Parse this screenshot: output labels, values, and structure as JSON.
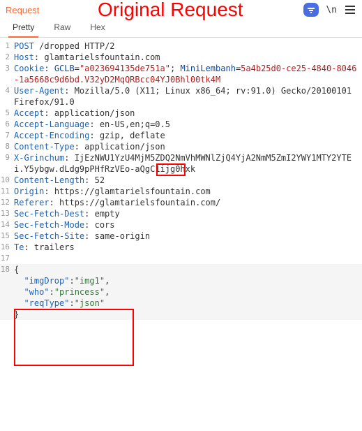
{
  "panel_title": "Request",
  "annotation": "Original Request",
  "escape_text": "\\n",
  "tabs": {
    "pretty": "Pretty",
    "raw": "Raw",
    "hex": "Hex"
  },
  "lines": {
    "l1": {
      "method": "POST",
      "path": "/dropped",
      "proto": "HTTP/2"
    },
    "l2": {
      "name": "Host",
      "val": "glamtarielsfountain.com"
    },
    "l3": {
      "name": "Cookie",
      "k1": "GCLB",
      "v1": "\"a023694135de751a\"",
      "k2": "MiniLembanh",
      "cont": "5a4b25d0-ce25-4840-8046-1a5668c9d6bd.V32yD2MqQRBcc04YJ0Bhl00tk4M"
    },
    "l4": {
      "name": "User-Agent",
      "val": "Mozilla/5.0 (X11; Linux x86_64; rv:91.0) Gecko/20100101 Firefox/91.0"
    },
    "l5": {
      "name": "Accept",
      "val": "application/json"
    },
    "l6": {
      "name": "Accept-Language",
      "val": "en-US,en;q=0.5"
    },
    "l7": {
      "name": "Accept-Encoding",
      "val": "gzip, deflate"
    },
    "l8": {
      "name": "Content-Type",
      "val_pre": "application/",
      "val_box": "json"
    },
    "l9": {
      "name": "X-Grinchum",
      "val": "IjEzNWU1YzU4MjM5ZDQ2NmVhMWNlZjQ4YjA2NmM5ZmI2YWY1MTY2YTEi.Y5ybgw.dLdg9pPHfRzVEo-aQgC1ijg0hxk"
    },
    "l10": {
      "name": "Content-Length",
      "val": "52"
    },
    "l11": {
      "name": "Origin",
      "val": "https://glamtarielsfountain.com"
    },
    "l12": {
      "name": "Referer",
      "val": "https://glamtarielsfountain.com/"
    },
    "l13": {
      "name": "Sec-Fetch-Dest",
      "val": "empty"
    },
    "l14": {
      "name": "Sec-Fetch-Mode",
      "val": "cors"
    },
    "l15": {
      "name": "Sec-Fetch-Site",
      "val": "same-origin"
    },
    "l16": {
      "name": "Te",
      "val": "trailers"
    },
    "body": {
      "open": "{",
      "r1k": "\"imgDrop\"",
      "r1v": "\"img1\"",
      "r2k": "\"who\"",
      "r2v": "\"princess\"",
      "r3k": "\"reqType\"",
      "r3v": "\"json\"",
      "close": "}"
    }
  }
}
